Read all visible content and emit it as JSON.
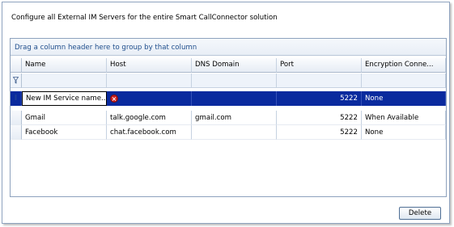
{
  "caption": "Configure all External IM Servers for the entire Smart CallConnector solution",
  "grid": {
    "group_hint": "Drag a column header here to group by that column",
    "columns": [
      "Name",
      "Host",
      "DNS Domain",
      "Port",
      "Encryption Conne..."
    ],
    "new_row": {
      "name": "New IM Service name...",
      "host": "",
      "dns": "",
      "port": "5222",
      "encryption": "None"
    },
    "rows": [
      {
        "name": "Gmail",
        "host": "talk.google.com",
        "dns": "gmail.com",
        "port": "5222",
        "encryption": "When Available"
      },
      {
        "name": "Facebook",
        "host": "chat.facebook.com",
        "dns": "",
        "port": "5222",
        "encryption": "None"
      }
    ]
  },
  "buttons": {
    "delete_label": "Delete"
  },
  "colors": {
    "selection": "#0a2a9e",
    "error": "#cc1f1f",
    "group_text": "#1f4e8c"
  }
}
